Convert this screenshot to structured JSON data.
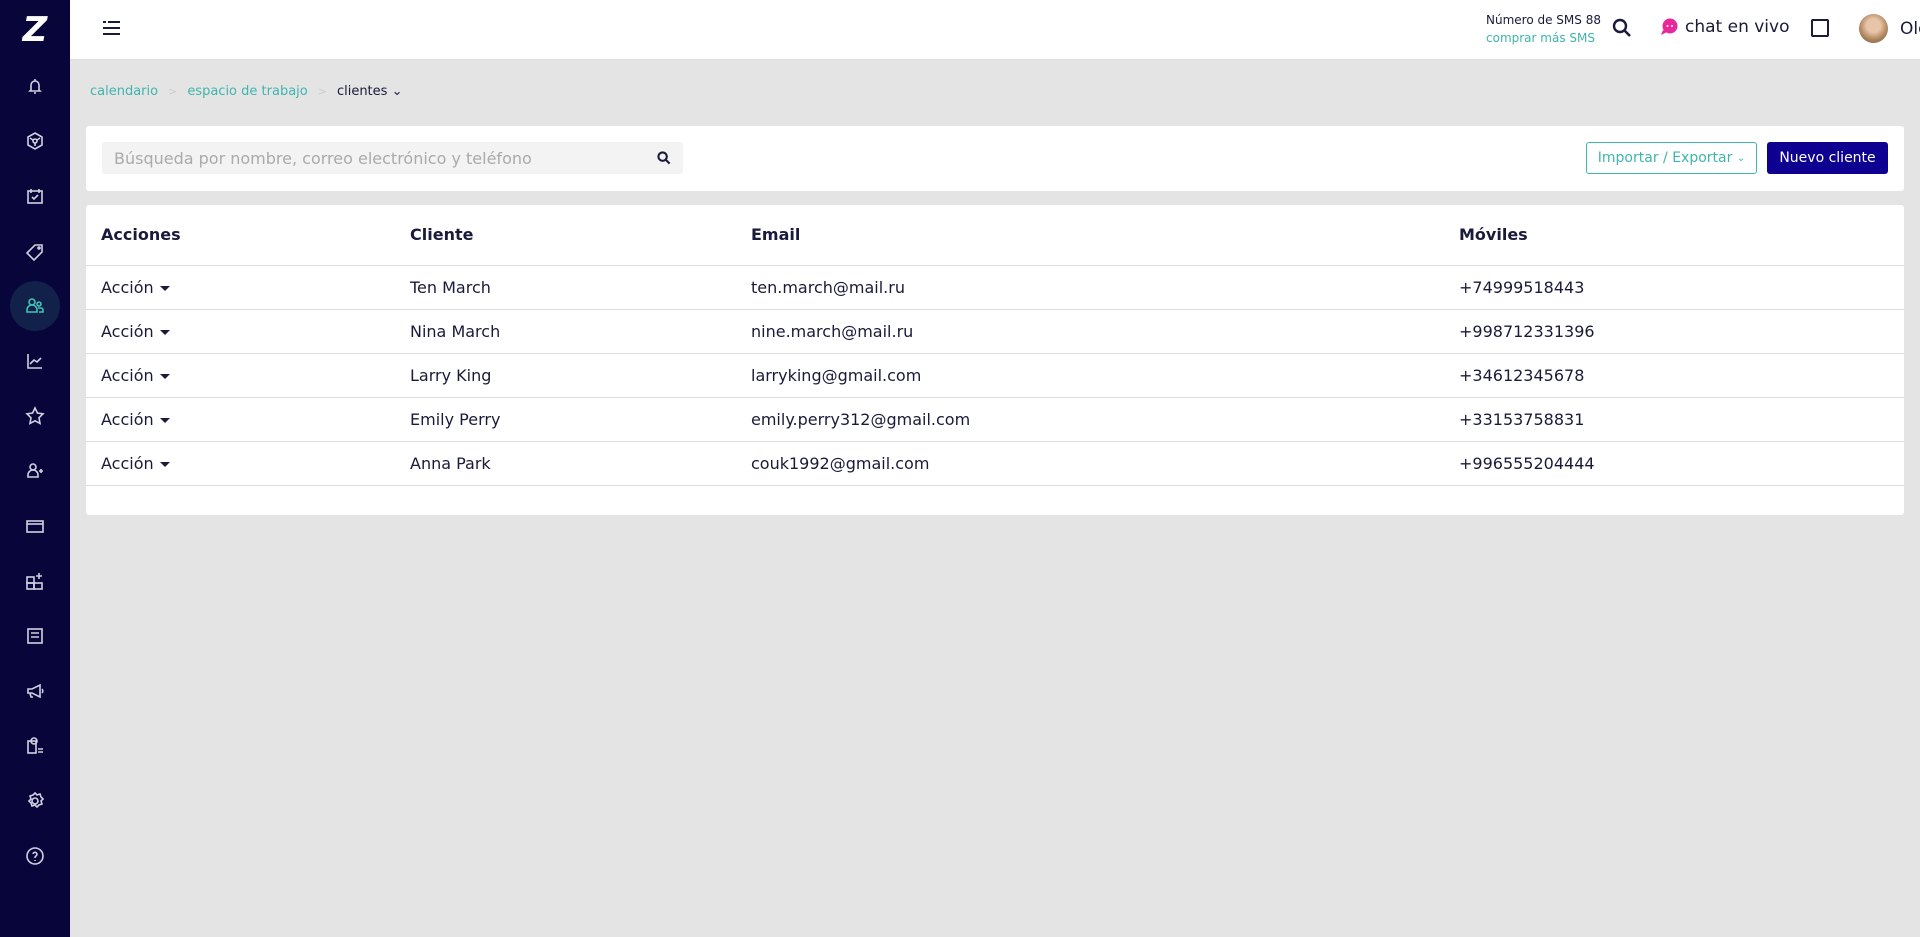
{
  "sidebar": {
    "logo": "Z",
    "items": [
      {
        "name": "notifications"
      },
      {
        "name": "dashboard"
      },
      {
        "name": "calendar"
      },
      {
        "name": "tags"
      },
      {
        "name": "clients",
        "active": true
      },
      {
        "name": "analytics"
      },
      {
        "name": "reviews"
      },
      {
        "name": "add-staff"
      },
      {
        "name": "payments"
      },
      {
        "name": "add-widget"
      },
      {
        "name": "save"
      },
      {
        "name": "marketing"
      },
      {
        "name": "services"
      },
      {
        "name": "settings"
      },
      {
        "name": "help"
      }
    ]
  },
  "topbar": {
    "sms_count": "Número de SMS 88",
    "buy_sms": "comprar más SMS",
    "chat": "chat en vivo",
    "user": "Olga"
  },
  "breadcrumb": [
    "calendario",
    "espacio de trabajo",
    "clientes"
  ],
  "search": {
    "placeholder": "Búsqueda por nombre, correo electrónico y teléfono"
  },
  "buttons": {
    "import_export": "Importar / Exportar",
    "new_client": "Nuevo cliente"
  },
  "table": {
    "headers": [
      "Acciones",
      "Cliente",
      "Email",
      "Móviles"
    ],
    "rows": [
      {
        "action": "Acción",
        "client": "Ten March",
        "email": "ten.march@mail.ru",
        "phone": "+74999518443"
      },
      {
        "action": "Acción",
        "client": "Nina March",
        "email": "nine.march@mail.ru",
        "phone": "+998712331396"
      },
      {
        "action": "Acción",
        "client": "Larry King",
        "email": "larryking@gmail.com",
        "phone": "+34612345678"
      },
      {
        "action": "Acción",
        "client": "Emily Perry",
        "email": "emily.perry312@gmail.com",
        "phone": "+33153758831"
      },
      {
        "action": "Acción",
        "client": "Anna Park",
        "email": "couk1992@gmail.com",
        "phone": "+996555204444"
      }
    ]
  },
  "colors": {
    "sidebar": "#07053a",
    "accent": "#3fb5ac",
    "primary": "#0e0090",
    "chat": "#e8289a"
  }
}
